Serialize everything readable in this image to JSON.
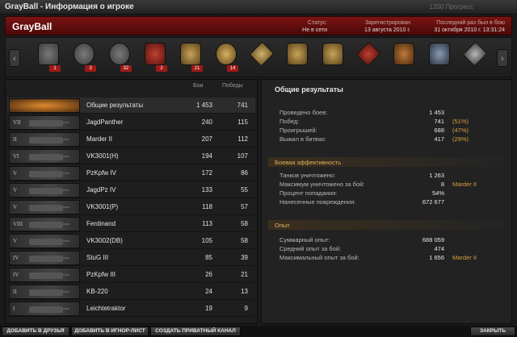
{
  "window": {
    "title": "GrayBall - Информация о игроке",
    "ghost_text": "1200 Прогресс"
  },
  "header": {
    "player": "GrayBall",
    "status_label": "Статус:",
    "status_value": "Не в сети",
    "registered_label": "Зарегистрирован",
    "registered_value": "13 августа 2010 г.",
    "last_seen_label": "Последний раз был в бою",
    "last_seen_value": "31 октября 2010 г. 13:31:24"
  },
  "medals": [
    {
      "name": "medal-1-icon",
      "count": "1"
    },
    {
      "name": "medal-2-icon",
      "count": "3"
    },
    {
      "name": "medal-3-icon",
      "count": "32"
    },
    {
      "name": "medal-4-icon",
      "count": "2"
    },
    {
      "name": "medal-5-icon",
      "count": "21"
    },
    {
      "name": "medal-6-icon",
      "count": "14"
    }
  ],
  "table": {
    "col_battles": "Бои",
    "col_wins": "Победы",
    "rows": [
      {
        "tier": "",
        "name": "Общие результаты",
        "battles": "1 453",
        "wins": "741"
      },
      {
        "tier": "VII",
        "name": "JagdPanther",
        "battles": "240",
        "wins": "115"
      },
      {
        "tier": "II",
        "name": "Marder II",
        "battles": "207",
        "wins": "112"
      },
      {
        "tier": "VI",
        "name": "VK3001(H)",
        "battles": "194",
        "wins": "107"
      },
      {
        "tier": "V",
        "name": "PzKpfw IV",
        "battles": "172",
        "wins": "86"
      },
      {
        "tier": "V",
        "name": "JagdPz IV",
        "battles": "133",
        "wins": "55"
      },
      {
        "tier": "V",
        "name": "VK3001(P)",
        "battles": "118",
        "wins": "57"
      },
      {
        "tier": "VIII",
        "name": "Ferdinand",
        "battles": "113",
        "wins": "58"
      },
      {
        "tier": "V",
        "name": "VK3002(DB)",
        "battles": "105",
        "wins": "58"
      },
      {
        "tier": "IV",
        "name": "StuG III",
        "battles": "85",
        "wins": "39"
      },
      {
        "tier": "IV",
        "name": "PzKpfw III",
        "battles": "26",
        "wins": "21"
      },
      {
        "tier": "II",
        "name": "KB-220",
        "battles": "24",
        "wins": "13"
      },
      {
        "tier": "I",
        "name": "Leichtetraktor",
        "battles": "19",
        "wins": "9"
      }
    ]
  },
  "results": {
    "title": "Общие результаты",
    "general": [
      {
        "k": "Проведено боев:",
        "v": "1 453",
        "x": ""
      },
      {
        "k": "Побед:",
        "v": "741",
        "x": "(51%)"
      },
      {
        "k": "Проигрышей:",
        "v": "688",
        "x": "(47%)"
      },
      {
        "k": "Выжил в битвах:",
        "v": "417",
        "x": "(29%)"
      }
    ],
    "combat_title": "Боевая эффективность",
    "combat": [
      {
        "k": "Танков уничтожено:",
        "v": "1 263",
        "x": ""
      },
      {
        "k": "Максимум уничтожено за бой:",
        "v": "8",
        "x": "Marder II"
      },
      {
        "k": "Процент попадания:",
        "v": "54%",
        "x": ""
      },
      {
        "k": "Нанесенные повреждения:",
        "v": "672 677",
        "x": ""
      }
    ],
    "xp_title": "Опыт",
    "xp": [
      {
        "k": "Суммарный опыт:",
        "v": "688 059",
        "x": ""
      },
      {
        "k": "Средний опыт за бой:",
        "v": "474",
        "x": ""
      },
      {
        "k": "Максимальный опыт за бой:",
        "v": "1 656",
        "x": "Marder II"
      }
    ]
  },
  "buttons": {
    "add_friend": "ДОБАВИТЬ В ДРУЗЬЯ",
    "add_ignore": "ДОБАВИТЬ В ИГНОР-ЛИСТ",
    "private_channel": "СОЗДАТЬ ПРИВАТНЫЙ КАНАЛ",
    "close": "ЗАКРЫТЬ"
  },
  "colors": {
    "accent_red": "#7a1412",
    "accent_orange": "#d8a040"
  }
}
